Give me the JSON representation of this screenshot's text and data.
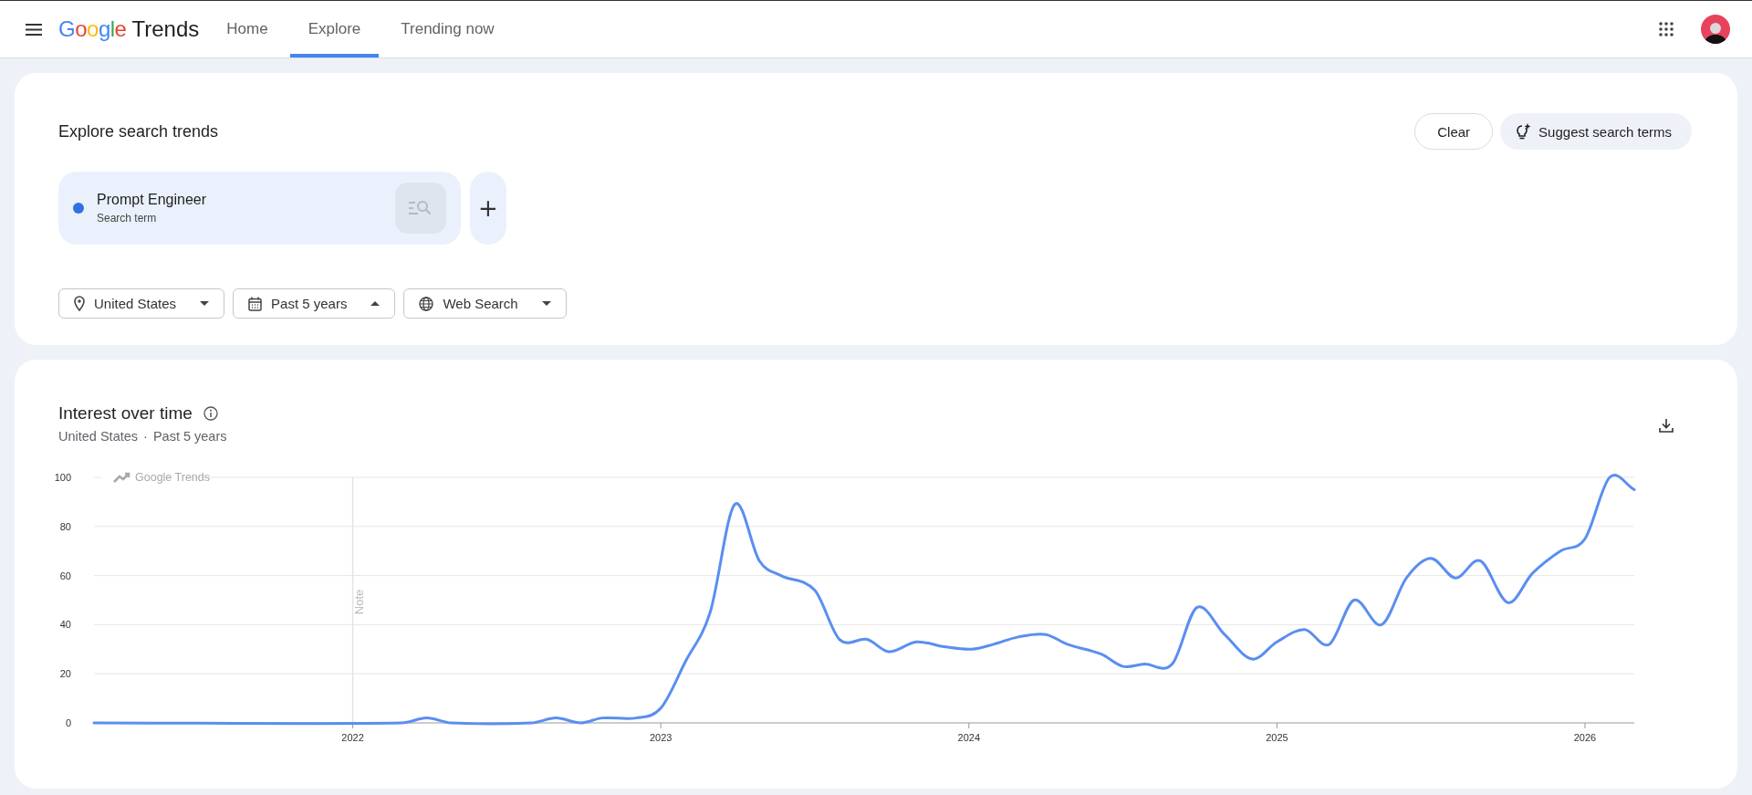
{
  "header": {
    "logo_brand": "Google",
    "logo_product": "Trends",
    "nav": [
      {
        "label": "Home",
        "selected": false
      },
      {
        "label": "Explore",
        "selected": true
      },
      {
        "label": "Trending now",
        "selected": false
      }
    ]
  },
  "explore": {
    "title": "Explore search trends",
    "clear_button": "Clear",
    "suggest_button": "Suggest search terms",
    "terms": [
      {
        "name": "Prompt Engineer",
        "subtitle": "Search term",
        "color": "#3171e0"
      }
    ],
    "add_button": "+",
    "filters": [
      {
        "kind": "location",
        "label": "United States",
        "expanded": false
      },
      {
        "kind": "date",
        "label": "Past 5 years",
        "expanded": true
      },
      {
        "kind": "property",
        "label": "Web Search",
        "expanded": false
      }
    ]
  },
  "interest": {
    "title": "Interest over time",
    "subtitle": [
      "United States",
      "Past 5 years"
    ],
    "subtitle_separator": "·",
    "watermark": "Google Trends",
    "chart_data": {
      "type": "line",
      "xlim": [
        2021.16,
        2026.16
      ],
      "ylim": [
        0,
        100
      ],
      "xticks": [
        2022,
        2023,
        2024,
        2025,
        2026
      ],
      "yticks": [
        0,
        20,
        40,
        60,
        80,
        100
      ],
      "grid": true,
      "ref_lines": [
        {
          "axis": "x",
          "value": 2022
        }
      ],
      "annotations": [
        "Note"
      ],
      "x": [
        2021.16,
        2022.16,
        2022.24,
        2022.32,
        2022.58,
        2022.66,
        2022.74,
        2022.81,
        2022.92,
        2023.0,
        2023.08,
        2023.16,
        2023.24,
        2023.32,
        2023.39,
        2023.5,
        2023.58,
        2023.67,
        2023.74,
        2023.83,
        2023.92,
        2024.01,
        2024.08,
        2024.16,
        2024.25,
        2024.32,
        2024.43,
        2024.5,
        2024.57,
        2024.66,
        2024.74,
        2024.83,
        2024.92,
        2025.0,
        2025.09,
        2025.17,
        2025.25,
        2025.34,
        2025.42,
        2025.5,
        2025.58,
        2025.66,
        2025.75,
        2025.83,
        2025.92,
        2026.0,
        2026.08,
        2026.16
      ],
      "series": [
        {
          "color": "#5a8ef0",
          "values": [
            0,
            0,
            2,
            0,
            0,
            2,
            0,
            2,
            2,
            6,
            25,
            45,
            89,
            66,
            60,
            54,
            34,
            34,
            29,
            33,
            31,
            30,
            32,
            35,
            36,
            32,
            28,
            23,
            24,
            24,
            47,
            36,
            26,
            33,
            38,
            32,
            50,
            40,
            59,
            67,
            59,
            66,
            49,
            61,
            70,
            75,
            100,
            95
          ]
        }
      ]
    }
  }
}
